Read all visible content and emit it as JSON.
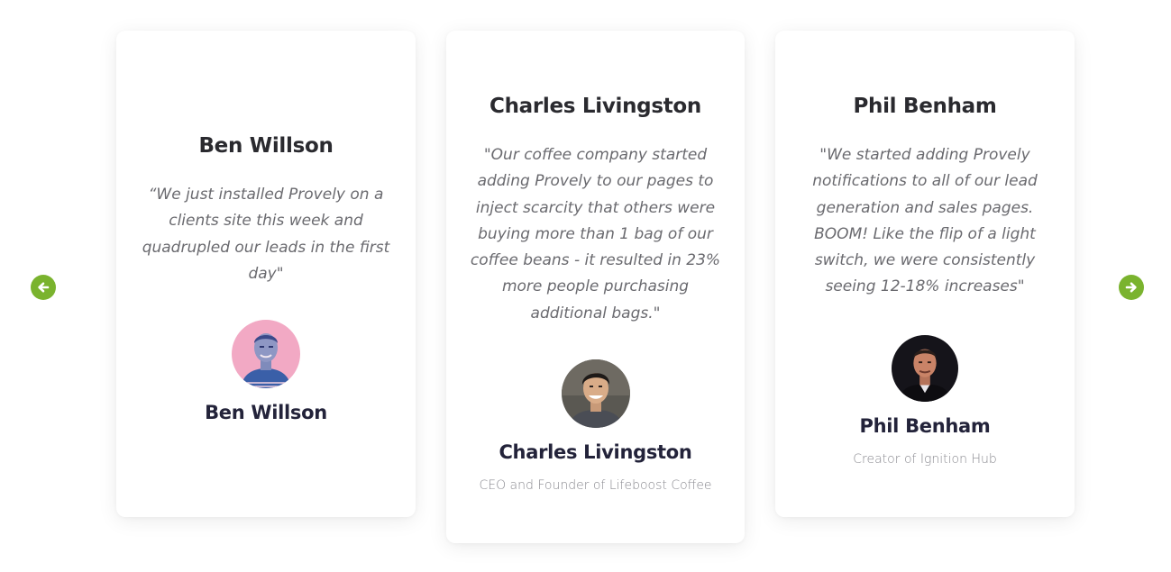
{
  "carousel": {
    "colors": {
      "arrow": "#7ab32e",
      "title": "#2a2a2f",
      "quote": "#6a6a6f",
      "name": "#23233a",
      "role": "#8a8a90"
    },
    "prev_icon": "arrow-left-circle-icon",
    "next_icon": "arrow-right-circle-icon",
    "testimonials": [
      {
        "title": "Ben Willson",
        "quote": "“We just installed Provely on a clients site this week and quadrupled our leads in the first day\"",
        "avatar_icon": "avatar-ben-willson",
        "name": "Ben Willson",
        "role": ""
      },
      {
        "title": "Charles Livingston",
        "quote": "\"Our coffee company started adding Provely to our pages to inject scarcity that others were buying more than 1 bag of our coffee beans - it resulted in 23% more people purchasing additional bags.\"",
        "avatar_icon": "avatar-charles-livingston",
        "name": "Charles Livingston",
        "role": "CEO and Founder of Lifeboost Coffee"
      },
      {
        "title": "Phil Benham",
        "quote": "\"We started adding Provely notifications to all of our lead generation and sales pages. BOOM! Like the flip of a light switch, we were consistently seeing 12-18% increases\"",
        "avatar_icon": "avatar-phil-benham",
        "name": "Phil Benham",
        "role": "Creator of Ignition Hub"
      }
    ]
  }
}
